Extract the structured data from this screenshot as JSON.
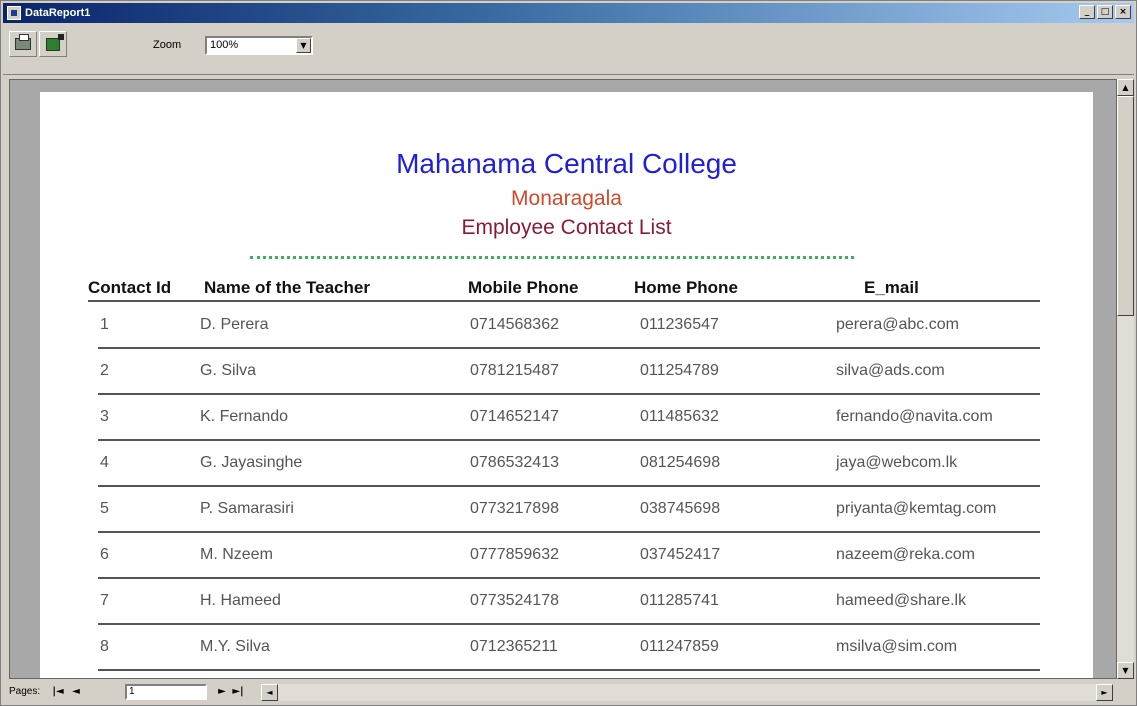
{
  "window": {
    "title": "DataReport1",
    "min": "_",
    "max": "□",
    "close": "×"
  },
  "toolbar": {
    "zoom_label": "Zoom",
    "zoom_value": "100%",
    "dropdown_arrow": "▼"
  },
  "report": {
    "title": "Mahanama Central College",
    "subtitle": "Monaragala",
    "heading": "Employee Contact List",
    "columns": [
      "Contact Id",
      "Name of the Teacher",
      "Mobile Phone",
      "Home Phone",
      "E_mail"
    ],
    "rows": [
      {
        "id": "1",
        "name": "D. Perera",
        "mobile": "0714568362",
        "home": "011236547",
        "email": "perera@abc.com"
      },
      {
        "id": "2",
        "name": "G. Silva",
        "mobile": "0781215487",
        "home": "011254789",
        "email": "silva@ads.com"
      },
      {
        "id": "3",
        "name": "K. Fernando",
        "mobile": "0714652147",
        "home": "011485632",
        "email": "fernando@navita.com"
      },
      {
        "id": "4",
        "name": "G. Jayasinghe",
        "mobile": "0786532413",
        "home": "081254698",
        "email": "jaya@webcom.lk"
      },
      {
        "id": "5",
        "name": "P. Samarasiri",
        "mobile": "0773217898",
        "home": "038745698",
        "email": "priyanta@kemtag.com"
      },
      {
        "id": "6",
        "name": "M. Nzeem",
        "mobile": "0777859632",
        "home": "037452417",
        "email": "nazeem@reka.com"
      },
      {
        "id": "7",
        "name": "H. Hameed",
        "mobile": "0773524178",
        "home": "011285741",
        "email": "hameed@share.lk"
      },
      {
        "id": "8",
        "name": "M.Y. Silva",
        "mobile": "0712365211",
        "home": "011247859",
        "email": "msilva@sim.com"
      }
    ]
  },
  "statusbar": {
    "pages_label": "Pages:",
    "page_value": "1",
    "first": "|◄",
    "prev": "◄",
    "next": "►",
    "last": "►|"
  },
  "scroll": {
    "up": "▲",
    "down": "▼",
    "left": "◄",
    "right": "►"
  },
  "icons": {
    "title": "report-icon",
    "print": "printer-icon",
    "export": "export-icon"
  }
}
